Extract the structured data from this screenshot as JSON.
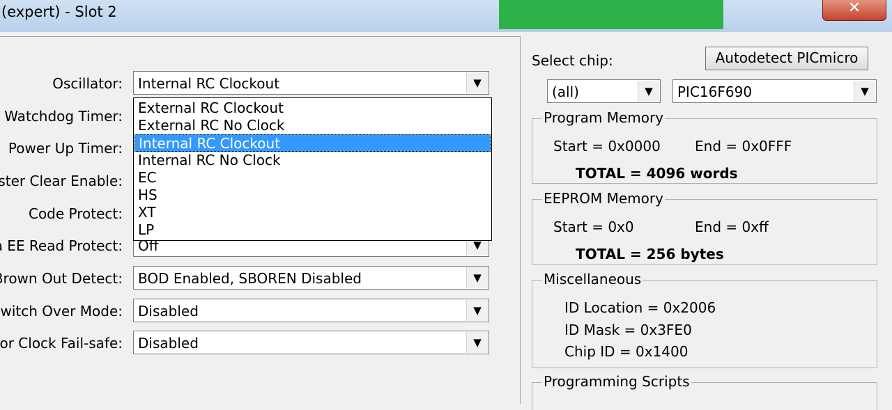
{
  "window": {
    "title": "(expert) - Slot 2",
    "close_glyph": "✕",
    "accent_green": "#2db24a",
    "selection_color": "#3399ff"
  },
  "config": {
    "rows": [
      {
        "label": "Oscillator:",
        "value": "Internal RC Clockout"
      },
      {
        "label": "Watchdog Timer:",
        "value": ""
      },
      {
        "label": "Power Up Timer:",
        "value": ""
      },
      {
        "label": "laster Clear Enable:",
        "value": ""
      },
      {
        "label": "Code Protect:",
        "value": ""
      },
      {
        "label": "a EE Read Protect:",
        "value": "Off"
      },
      {
        "label": "Brown Out Detect:",
        "value": "BOD Enabled, SBOREN Disabled"
      },
      {
        "label": "Switch Over Mode:",
        "value": "Disabled"
      },
      {
        "label": "itor Clock Fail-safe:",
        "value": "Disabled"
      }
    ],
    "arrow_glyph": "▼",
    "dropdown_options": [
      "External RC Clockout",
      "External RC No Clock",
      "Internal RC Clockout",
      "Internal RC No Clock",
      "EC",
      "HS",
      "XT",
      "LP"
    ],
    "selected_option": "Internal RC Clockout"
  },
  "chip": {
    "select_label": "Select chip:",
    "autodetect_label": "Autodetect PICmicro",
    "family_value": "(all)",
    "chip_value": "PIC16F690"
  },
  "program_memory": {
    "title": "Program Memory",
    "start": "Start = 0x0000",
    "end": "End = 0x0FFF",
    "total": "TOTAL = 4096 words"
  },
  "eeprom_memory": {
    "title": "EEPROM Memory",
    "start": "Start = 0x0",
    "end": "End = 0xff",
    "total": "TOTAL = 256 bytes"
  },
  "misc": {
    "title": "Miscellaneous",
    "id_location": "ID Location = 0x2006",
    "id_mask": "ID Mask = 0x3FE0",
    "chip_id": "Chip ID = 0x1400"
  },
  "scripts": {
    "title": "Programming Scripts"
  }
}
